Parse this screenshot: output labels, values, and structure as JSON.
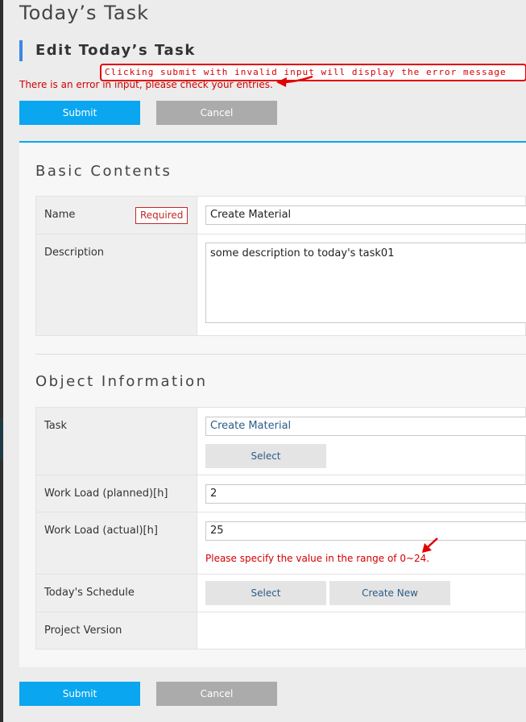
{
  "page": {
    "title": "Today’s Task",
    "section_heading": "Edit Today’s Task",
    "annotation": "Clicking submit with invalid input will display the error message",
    "global_error": "There is an error in input, please check your entries.",
    "submit_label": "Submit",
    "cancel_label": "Cancel"
  },
  "basic": {
    "title": "Basic Contents",
    "name_label": "Name",
    "required_badge": "Required",
    "name_value": "Create Material",
    "description_label": "Description",
    "description_value": "some description to today's task01"
  },
  "object": {
    "title": "Object Information",
    "task_label": "Task",
    "task_value": "Create Material",
    "select_label": "Select",
    "planned_label": "Work Load (planned)[h]",
    "planned_value": "2",
    "actual_label": "Work Load (actual)[h]",
    "actual_value": "25",
    "actual_error": "Please specify the value in the range of 0~24.",
    "schedule_label": "Today's Schedule",
    "schedule_select": "Select",
    "schedule_create": "Create New",
    "project_version_label": "Project Version"
  },
  "colors": {
    "accent": "#0aa6f0",
    "error": "#d40000",
    "heading_bar": "#3b87e6"
  }
}
